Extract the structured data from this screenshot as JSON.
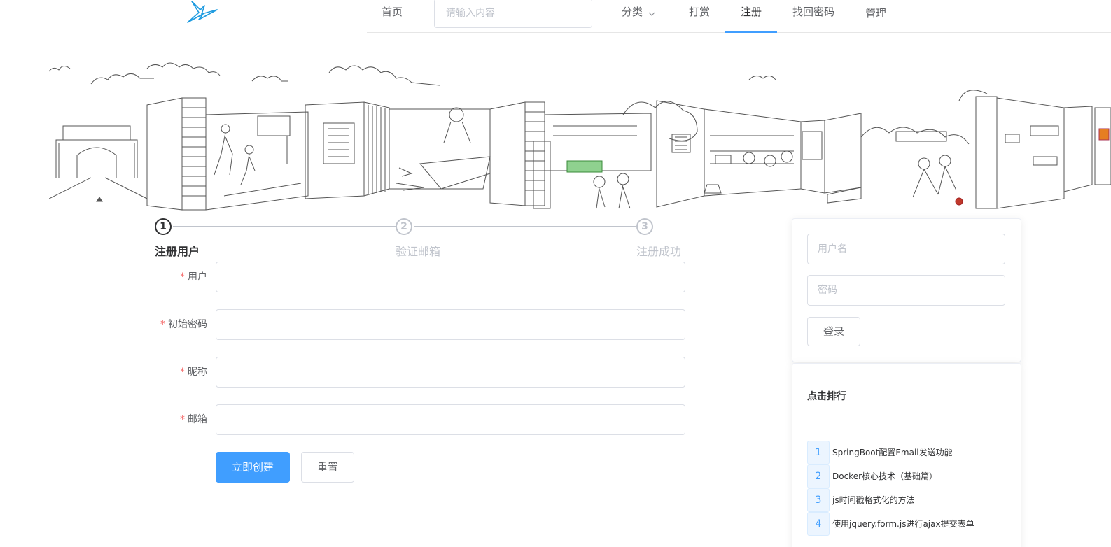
{
  "header": {
    "nav": {
      "home": "首页",
      "category": "分类",
      "reward": "打赏",
      "register": "注册",
      "recover_password": "找回密码",
      "manage": "管理"
    },
    "search": {
      "placeholder": "请输入内容",
      "value": ""
    },
    "logo_icon": "lightning-bird-logo-icon",
    "active_tab": "注册",
    "accent_color": "#409eff"
  },
  "steps": {
    "items": [
      {
        "number": "1",
        "title": "注册用户",
        "status": "active"
      },
      {
        "number": "2",
        "title": "验证邮箱",
        "status": "wait"
      },
      {
        "number": "3",
        "title": "注册成功",
        "status": "wait"
      }
    ]
  },
  "form": {
    "required_mark": "*",
    "fields": [
      {
        "label": "用户",
        "value": ""
      },
      {
        "label": "初始密码",
        "value": ""
      },
      {
        "label": "昵称",
        "value": ""
      },
      {
        "label": "邮箱",
        "value": ""
      }
    ],
    "submit_label": "立即创建",
    "reset_label": "重置"
  },
  "login": {
    "username_placeholder": "用户名",
    "password_placeholder": "密码",
    "login_label": "登录"
  },
  "ranking": {
    "title": "点击排行",
    "items": [
      {
        "rank": "1",
        "title": "SpringBoot配置Email发送功能"
      },
      {
        "rank": "2",
        "title": "Docker核心技术（基础篇）"
      },
      {
        "rank": "3",
        "title": "js时间戳格式化的方法"
      },
      {
        "rank": "4",
        "title": "使用jquery.form.js进行ajax提交表单"
      }
    ]
  }
}
